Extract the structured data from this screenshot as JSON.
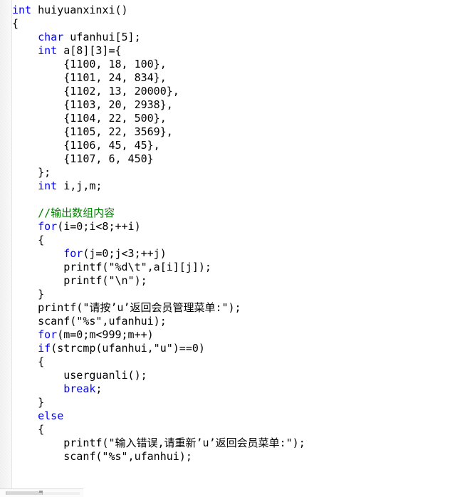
{
  "editor": {
    "language": "c",
    "colors": {
      "background": "#ffffff",
      "text": "#000000",
      "keyword": "#0000ff",
      "comment": "#008000",
      "gutter": "#f5f5f5"
    },
    "scrollbar": {
      "orientation": "horizontal",
      "visible": true
    }
  },
  "code": {
    "lines": [
      {
        "indent": 0,
        "tokens": [
          {
            "t": "kw",
            "v": "int"
          },
          {
            "t": "tx",
            "v": " huiyuanxinxi()"
          }
        ]
      },
      {
        "indent": 0,
        "tokens": [
          {
            "t": "tx",
            "v": "{"
          }
        ]
      },
      {
        "indent": 1,
        "tokens": [
          {
            "t": "kw",
            "v": "char"
          },
          {
            "t": "tx",
            "v": " ufanhui[5];"
          }
        ]
      },
      {
        "indent": 1,
        "tokens": [
          {
            "t": "kw",
            "v": "int"
          },
          {
            "t": "tx",
            "v": " a[8][3]={"
          }
        ]
      },
      {
        "indent": 2,
        "tokens": [
          {
            "t": "tx",
            "v": "{1100, 18, 100},"
          }
        ]
      },
      {
        "indent": 2,
        "tokens": [
          {
            "t": "tx",
            "v": "{1101, 24, 834},"
          }
        ]
      },
      {
        "indent": 2,
        "tokens": [
          {
            "t": "tx",
            "v": "{1102, 13, 20000},"
          }
        ]
      },
      {
        "indent": 2,
        "tokens": [
          {
            "t": "tx",
            "v": "{1103, 20, 2938},"
          }
        ]
      },
      {
        "indent": 2,
        "tokens": [
          {
            "t": "tx",
            "v": "{1104, 22, 500},"
          }
        ]
      },
      {
        "indent": 2,
        "tokens": [
          {
            "t": "tx",
            "v": "{1105, 22, 3569},"
          }
        ]
      },
      {
        "indent": 2,
        "tokens": [
          {
            "t": "tx",
            "v": "{1106, 45, 45},"
          }
        ]
      },
      {
        "indent": 2,
        "tokens": [
          {
            "t": "tx",
            "v": "{1107, 6, 450}"
          }
        ]
      },
      {
        "indent": 1,
        "tokens": [
          {
            "t": "tx",
            "v": "};"
          }
        ]
      },
      {
        "indent": 1,
        "tokens": [
          {
            "t": "kw",
            "v": "int"
          },
          {
            "t": "tx",
            "v": " i,j,m;"
          }
        ]
      },
      {
        "indent": 0,
        "blank": true,
        "tokens": []
      },
      {
        "indent": 1,
        "tokens": [
          {
            "t": "cm",
            "v": "//输出数组内容"
          }
        ]
      },
      {
        "indent": 1,
        "tokens": [
          {
            "t": "kw",
            "v": "for"
          },
          {
            "t": "tx",
            "v": "(i=0;i<8;++i)"
          }
        ]
      },
      {
        "indent": 1,
        "tokens": [
          {
            "t": "tx",
            "v": "{"
          }
        ]
      },
      {
        "indent": 2,
        "tokens": [
          {
            "t": "kw",
            "v": "for"
          },
          {
            "t": "tx",
            "v": "(j=0;j<3;++j)"
          }
        ]
      },
      {
        "indent": 2,
        "tokens": [
          {
            "t": "tx",
            "v": "printf(\"%d\\t\",a[i][j]);"
          }
        ]
      },
      {
        "indent": 2,
        "tokens": [
          {
            "t": "tx",
            "v": "printf(\"\\n\");"
          }
        ]
      },
      {
        "indent": 1,
        "tokens": [
          {
            "t": "tx",
            "v": "}"
          }
        ]
      },
      {
        "indent": 1,
        "tokens": [
          {
            "t": "tx",
            "v": "printf(\"请按’u’返回会员管理菜单:\");"
          }
        ]
      },
      {
        "indent": 1,
        "tokens": [
          {
            "t": "tx",
            "v": "scanf(\"%s\",ufanhui);"
          }
        ]
      },
      {
        "indent": 1,
        "tokens": [
          {
            "t": "kw",
            "v": "for"
          },
          {
            "t": "tx",
            "v": "(m=0;m<999;m++)"
          }
        ]
      },
      {
        "indent": 1,
        "tokens": [
          {
            "t": "kw",
            "v": "if"
          },
          {
            "t": "tx",
            "v": "(strcmp(ufanhui,\"u\")==0)"
          }
        ]
      },
      {
        "indent": 1,
        "tokens": [
          {
            "t": "tx",
            "v": "{"
          }
        ]
      },
      {
        "indent": 2,
        "tokens": [
          {
            "t": "tx",
            "v": "userguanli();"
          }
        ]
      },
      {
        "indent": 2,
        "tokens": [
          {
            "t": "kw",
            "v": "break"
          },
          {
            "t": "tx",
            "v": ";"
          }
        ]
      },
      {
        "indent": 1,
        "tokens": [
          {
            "t": "tx",
            "v": "}"
          }
        ]
      },
      {
        "indent": 1,
        "tokens": [
          {
            "t": "kw",
            "v": "else"
          }
        ]
      },
      {
        "indent": 1,
        "tokens": [
          {
            "t": "tx",
            "v": "{"
          }
        ]
      },
      {
        "indent": 2,
        "tokens": [
          {
            "t": "tx",
            "v": "printf(\"输入错误,请重新’u’返回会员菜单:\");"
          }
        ]
      },
      {
        "indent": 2,
        "tokens": [
          {
            "t": "tx",
            "v": "scanf(\"%s\",ufanhui);"
          }
        ]
      }
    ]
  }
}
